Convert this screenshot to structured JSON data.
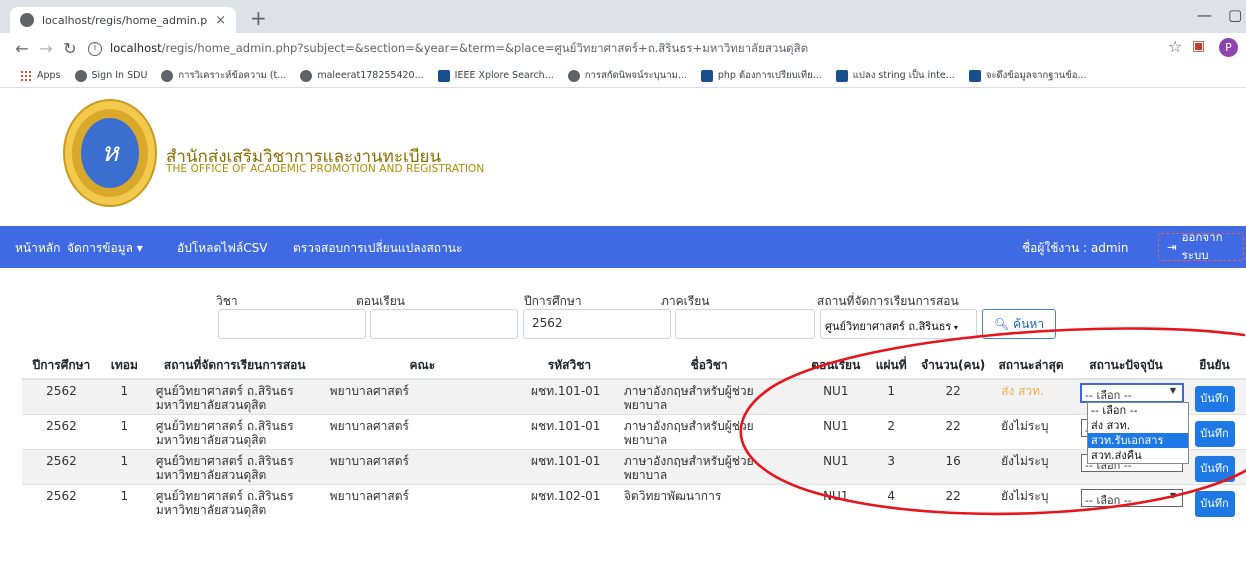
{
  "browser": {
    "tab_title": "localhost/regis/home_admin.php",
    "tab_close": "×",
    "new_tab": "+",
    "url_host": "localhost",
    "url_rest": "/regis/home_admin.php?subject=&section=&year=&term=&place=ศูนย์วิทยาศาสตร์+ถ.สิรินธร+มหาวิทยาลัยสวนดุสิต",
    "bookmarks": [
      {
        "label": "Apps",
        "icon": "apps-icon"
      },
      {
        "label": "Sign In SDU",
        "icon": "globe-icon"
      },
      {
        "label": "การวิเคราะห์ข้อความ (t...",
        "icon": "globe-icon"
      },
      {
        "label": "maleerat178255420...",
        "icon": "globe-icon"
      },
      {
        "label": "IEEE Xplore Search...",
        "icon": "ieee-icon"
      },
      {
        "label": "การสกัดนิพจน์ระบุนาม...",
        "icon": "globe-icon"
      },
      {
        "label": "php ต้องการเปรียบเทีย...",
        "icon": "page-icon"
      },
      {
        "label": "แปลง string เป็น inte...",
        "icon": "page-icon"
      },
      {
        "label": "จะดึงข้อมูลจากฐานข้อ...",
        "icon": "page-icon"
      }
    ],
    "profile_initial": "P"
  },
  "header": {
    "title_th": "สำนักส่งเสริมวิชาการและงานทะเบียน",
    "title_en": "THE OFFICE OF ACADEMIC PROMOTION AND REGISTRATION"
  },
  "nav": {
    "home": "หน้าหลัก",
    "manage": "จัดการข้อมูล ▾",
    "upload": "อัปโหลดไฟล์CSV",
    "check": "ตรวจสอบการเปลี่ยนแปลงสถานะ",
    "user": "ชื่อผู้ใช้งาน : admin",
    "logout": "ออกจากระบบ"
  },
  "search": {
    "subject_label": "วิชา",
    "section_label": "ตอนเรียน",
    "year_label": "ปีการศึกษา",
    "term_label": "ภาคเรียน",
    "place_label": "สถานที่จัดการเรียนการสอน",
    "subject_value": "",
    "section_value": "",
    "year_value": "2562",
    "term_value": "",
    "place_value": "ศูนย์วิทยาศาสตร์ ถ.สิรินธร",
    "button": "ค้นหา"
  },
  "table": {
    "columns": [
      "ปีการศึกษา",
      "เทอม",
      "สถานที่จัดการเรียนการสอน",
      "คณะ",
      "รหัสวิชา",
      "ชื่อวิชา",
      "ตอนเรียน",
      "แผ่นที่",
      "จำนวน(คน)",
      "สถานะล่าสุด",
      "สถานะปัจจุบัน",
      "ยืนยัน"
    ],
    "rows": [
      {
        "year": "2562",
        "term": "1",
        "place1": "ศูนย์วิทยาศาสตร์ ถ.สิรินธร",
        "place2": "มหาวิทยาลัยสวนดุสิต",
        "faculty": "พยาบาลศาสตร์",
        "code": "ผชท.101-01",
        "name1": "ภาษาอังกฤษสำหรับผู้ช่วย",
        "name2": "พยาบาล",
        "section": "NU1",
        "sheet": "1",
        "count": "22",
        "latest": "ส่ง สวท.",
        "current": "-- เลือก --",
        "confirm": "บันทึก"
      },
      {
        "year": "2562",
        "term": "1",
        "place1": "ศูนย์วิทยาศาสตร์ ถ.สิรินธร",
        "place2": "มหาวิทยาลัยสวนดุสิต",
        "faculty": "พยาบาลศาสตร์",
        "code": "ผชท.101-01",
        "name1": "ภาษาอังกฤษสำหรับผู้ช่วย",
        "name2": "พยาบาล",
        "section": "NU1",
        "sheet": "2",
        "count": "22",
        "latest": "ยังไม่ระบุ",
        "current": "-- เลือก --",
        "confirm": "บันทึก"
      },
      {
        "year": "2562",
        "term": "1",
        "place1": "ศูนย์วิทยาศาสตร์ ถ.สิรินธร",
        "place2": "มหาวิทยาลัยสวนดุสิต",
        "faculty": "พยาบาลศาสตร์",
        "code": "ผชท.101-01",
        "name1": "ภาษาอังกฤษสำหรับผู้ช่วย",
        "name2": "พยาบาล",
        "section": "NU1",
        "sheet": "3",
        "count": "16",
        "latest": "ยังไม่ระบุ",
        "current": "-- เลือก --",
        "confirm": "บันทึก"
      },
      {
        "year": "2562",
        "term": "1",
        "place1": "ศูนย์วิทยาศาสตร์ ถ.สิรินธร",
        "place2": "มหาวิทยาลัยสวนดุสิต",
        "faculty": "พยาบาลศาสตร์",
        "code": "ผชท.102-01",
        "name1": "จิตวิทยาพัฒนาการ",
        "name2": "",
        "section": "NU1",
        "sheet": "4",
        "count": "22",
        "latest": "ยังไม่ระบุ",
        "current": "-- เลือก --",
        "confirm": "บันทึก"
      }
    ]
  },
  "dropdown_options": [
    "-- เลือก --",
    "ส่ง สวท.",
    "สวท.รับเอกสาร",
    "สวท.ส่งคืน"
  ],
  "dropdown_highlighted_index": 2,
  "colors": {
    "nav": "#3f6ae3",
    "button": "#1e78e6",
    "latest_sent": "#f0ad4e",
    "annotation": "#e8141c"
  }
}
